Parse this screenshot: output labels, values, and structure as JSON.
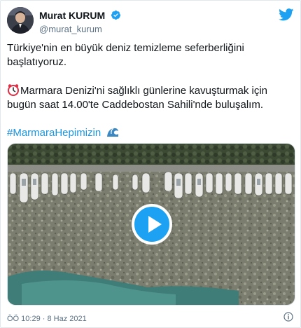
{
  "author": {
    "display_name": "Murat KURUM",
    "handle": "@murat_kurum"
  },
  "tweet": {
    "line1": "Türkiye'nin en büyük deniz temizleme seferberliğini başlatıyoruz.",
    "line2": "Marmara Denizi'ni sağlıklı günlerine kavuşturmak için bugün saat 14.00'te Caddebostan Sahili'nde buluşalım.",
    "hashtag": "#MarmaraHepimizin"
  },
  "footer": {
    "timestamp": "ÖÖ 10:29 · 8 Haz 2021"
  },
  "icons": {
    "verified": "verified-badge-icon",
    "twitter": "twitter-bird-icon",
    "clock": "alarm-clock-icon",
    "wave": "water-wave-icon",
    "play": "play-icon",
    "info": "info-icon"
  },
  "colors": {
    "accent": "#1da1f2",
    "hashtag": "#1b95e0",
    "muted": "#5b7083"
  }
}
